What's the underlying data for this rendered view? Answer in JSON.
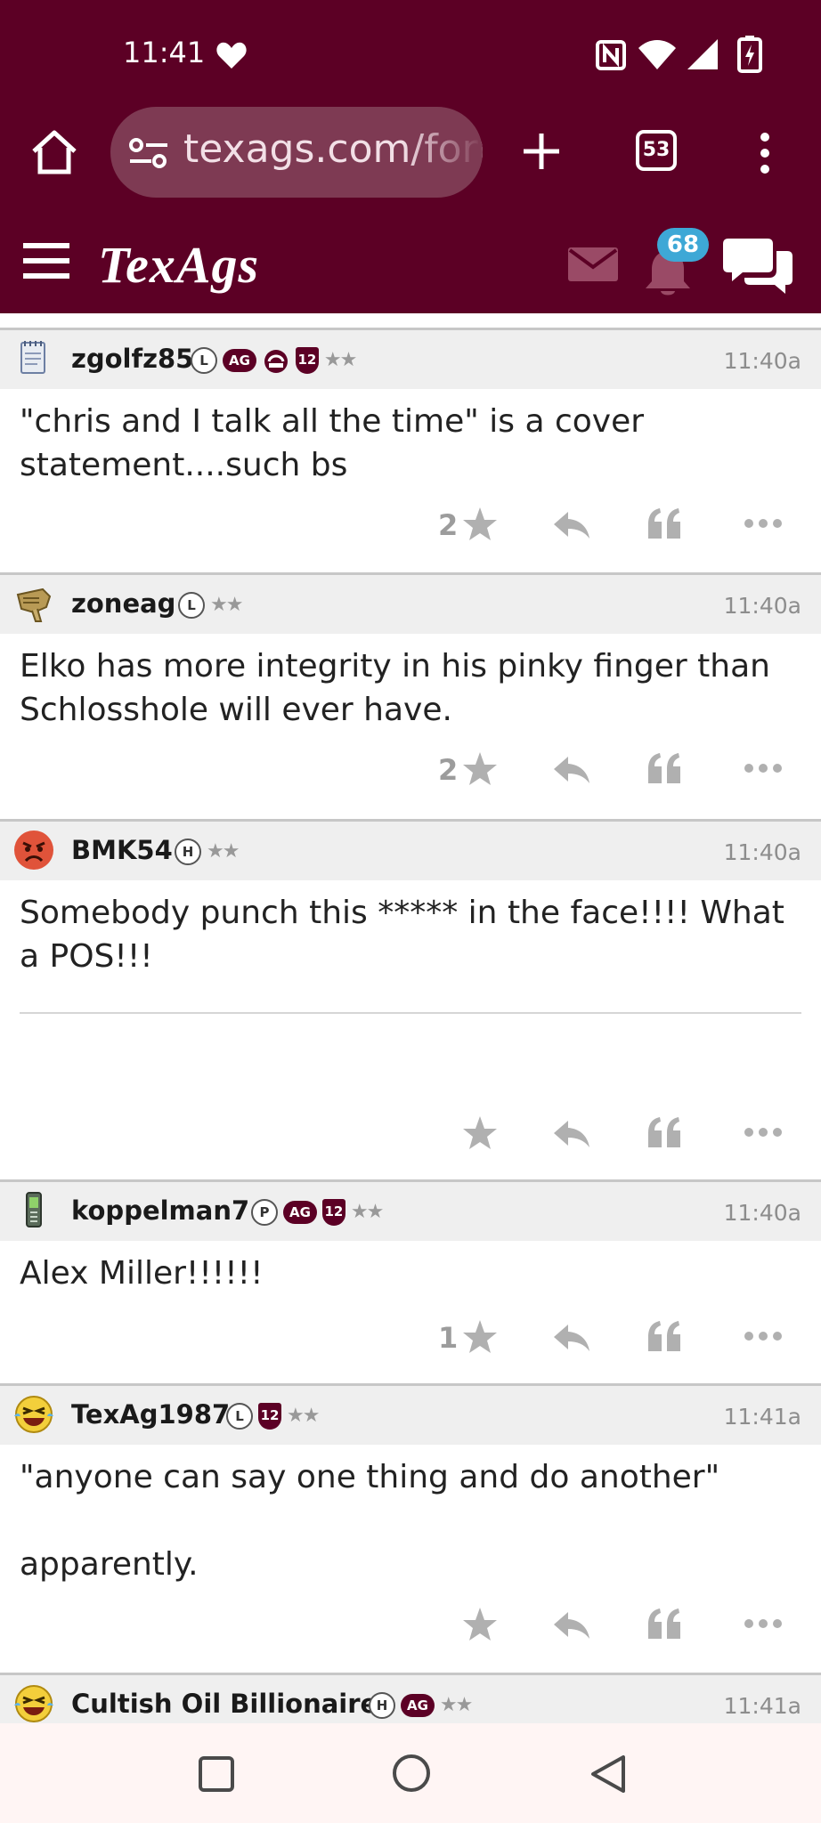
{
  "status_bar": {
    "time": "11:41"
  },
  "browser": {
    "url": "texags.com/forums",
    "tab_count": "53"
  },
  "site": {
    "logo": "TexAgs",
    "notification_count": "68"
  },
  "colors": {
    "brand": "#5c0025",
    "badge_blue": "#3ea8d6",
    "action_gray": "#b0b0b0"
  },
  "posts": [
    {
      "username": "zgolfz85",
      "badges": [
        "L",
        "AG",
        "12th-man-helmet",
        "12",
        "stars"
      ],
      "time": "11:40a",
      "body": [
        "\"chris and I talk all the time\" is a cover statement....such bs"
      ],
      "stars": "2"
    },
    {
      "username": "zoneag",
      "badges": [
        "L",
        "stars"
      ],
      "time": "11:40a",
      "body": [
        "Elko has more integrity in his pinky finger than Schlosshole will ever have."
      ],
      "stars": "2"
    },
    {
      "username": "BMK54",
      "badges": [
        "H",
        "stars"
      ],
      "time": "11:40a",
      "body": [
        "Somebody punch this ***** in the face!!!! What a POS!!!"
      ],
      "stars": ""
    },
    {
      "username": "koppelman7",
      "badges": [
        "P",
        "AG",
        "12",
        "stars"
      ],
      "time": "11:40a",
      "body": [
        "Alex Miller!!!!!!"
      ],
      "stars": "1"
    },
    {
      "username": "TexAg1987",
      "badges": [
        "L",
        "12",
        "stars"
      ],
      "time": "11:41a",
      "body": [
        "\"anyone can say one thing and do another\"",
        "apparently."
      ],
      "stars": ""
    },
    {
      "username": "Cultish Oil Billionaire",
      "badges": [
        "H",
        "AG",
        "stars"
      ],
      "time": "11:41a",
      "body": [],
      "stars": ""
    }
  ],
  "badge_labels": {
    "L": "L",
    "H": "H",
    "P": "P",
    "AG": "AG",
    "twelve": "12",
    "stars": "★★"
  }
}
